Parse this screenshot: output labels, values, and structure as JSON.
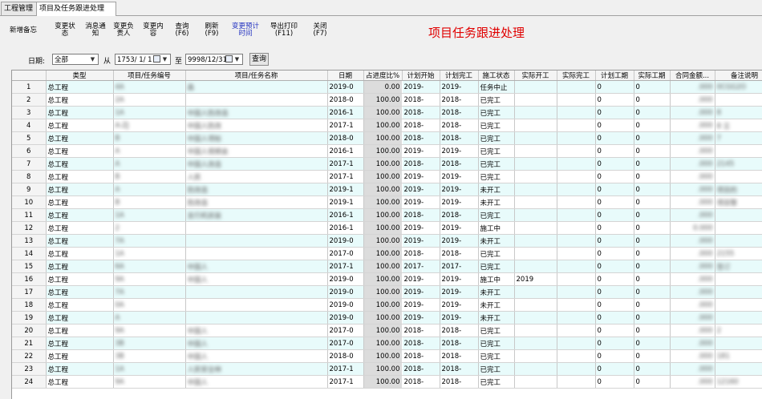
{
  "tabs": [
    {
      "label": "工程管理"
    },
    {
      "label": "项目及任务跟进处理"
    }
  ],
  "toolbar": {
    "buttons": [
      {
        "line1": "新增备忘",
        "line2": ""
      },
      {
        "line1": "变更状",
        "line2": "态"
      },
      {
        "line1": "消息通",
        "line2": "知"
      },
      {
        "line1": "变更负",
        "line2": "责人"
      },
      {
        "line1": "变更内",
        "line2": "容"
      },
      {
        "line1": "查询",
        "line2": "(F6)"
      },
      {
        "line1": "刷新",
        "line2": "(F9)"
      },
      {
        "line1": "变更预计",
        "line2": "时间"
      },
      {
        "line1": "导出打印",
        "line2": "(F11)"
      },
      {
        "line1": "关闭",
        "line2": "(F7)"
      }
    ]
  },
  "page_title": "项目任务跟进处理",
  "filter": {
    "date_label": "日期:",
    "date_range_value": "全部",
    "from_label": "从",
    "from_date": "1753/ 1/ 1",
    "to_label": "至",
    "to_date": "9998/12/31",
    "query_label": "查询"
  },
  "columns": [
    "",
    "类型",
    "项目/任务编号",
    "项目/任务名称",
    "日期",
    "占进度比%",
    "计划开始",
    "计划完工",
    "施工状态",
    "实际开工",
    "实际完工",
    "计划工期",
    "实际工期",
    "合同金额...",
    "备注说明"
  ],
  "rows": [
    {
      "n": "1",
      "type": "总工程",
      "code": "4A",
      "name": "森",
      "date": "2019-0",
      "prog": "0.00",
      "ps": "2019-",
      "pe": "2019-",
      "status": "任务中止",
      "as": "",
      "ae": "",
      "pd": "0",
      "ad": "0",
      "amt": ".000",
      "note": "0CGG2O"
    },
    {
      "n": "2",
      "type": "总工程",
      "code": "2A",
      "name": "",
      "date": "2018-0",
      "prog": "100.00",
      "ps": "2018-",
      "pe": "2018-",
      "status": "已完工",
      "as": "",
      "ae": "",
      "pd": "0",
      "ad": "0",
      "amt": ".000",
      "note": ""
    },
    {
      "n": "3",
      "type": "总工程",
      "code": "1A",
      "name": "中国人防改造",
      "date": "2016-1",
      "prog": "100.00",
      "ps": "2018-",
      "pe": "2018-",
      "status": "已完工",
      "as": "",
      "ae": "",
      "pd": "0",
      "ad": "0",
      "amt": ".000",
      "note": "8"
    },
    {
      "n": "4",
      "type": "总工程",
      "code": "A-ZJ",
      "name": "中国人防改",
      "date": "2017-1",
      "prog": "100.00",
      "ps": "2018-",
      "pe": "2018-",
      "status": "已完工",
      "as": "",
      "ae": "",
      "pd": "0",
      "ad": "0",
      "amt": ".000",
      "note": "8 立"
    },
    {
      "n": "5",
      "type": "总工程",
      "code": "B",
      "name": "中国人项标",
      "date": "2018-0",
      "prog": "100.00",
      "ps": "2018-",
      "pe": "2018-",
      "status": "已完工",
      "as": "",
      "ae": "",
      "pd": "0",
      "ad": "0",
      "amt": ".000",
      "note": "7"
    },
    {
      "n": "6",
      "type": "总工程",
      "code": "A",
      "name": "中国人视频会",
      "date": "2016-1",
      "prog": "100.00",
      "ps": "2019-",
      "pe": "2019-",
      "status": "已完工",
      "as": "",
      "ae": "",
      "pd": "0",
      "ad": "0",
      "amt": ".000",
      "note": ""
    },
    {
      "n": "7",
      "type": "总工程",
      "code": "A",
      "name": "中国人改造",
      "date": "2017-1",
      "prog": "100.00",
      "ps": "2018-",
      "pe": "2018-",
      "status": "已完工",
      "as": "",
      "ae": "",
      "pd": "0",
      "ad": "0",
      "amt": ".000",
      "note": "2145"
    },
    {
      "n": "8",
      "type": "总工程",
      "code": "B",
      "name": "人民",
      "date": "2017-1",
      "prog": "100.00",
      "ps": "2019-",
      "pe": "2019-",
      "status": "已完工",
      "as": "",
      "ae": "",
      "pd": "0",
      "ad": "0",
      "amt": ".000",
      "note": ""
    },
    {
      "n": "9",
      "type": "总工程",
      "code": "A",
      "name": "防改造",
      "date": "2019-1",
      "prog": "100.00",
      "ps": "2019-",
      "pe": "2019-",
      "status": "未开工",
      "as": "",
      "ae": "",
      "pd": "0",
      "ad": "0",
      "amt": ".000",
      "note": "项目的"
    },
    {
      "n": "10",
      "type": "总工程",
      "code": "B",
      "name": "防改造",
      "date": "2019-1",
      "prog": "100.00",
      "ps": "2019-",
      "pe": "2019-",
      "status": "未开工",
      "as": "",
      "ae": "",
      "pd": "0",
      "ad": "0",
      "amt": ".000",
      "note": "项目整"
    },
    {
      "n": "11",
      "type": "总工程",
      "code": "1A",
      "name": "支行机房装",
      "date": "2016-1",
      "prog": "100.00",
      "ps": "2018-",
      "pe": "2018-",
      "status": "已完工",
      "as": "",
      "ae": "",
      "pd": "0",
      "ad": "0",
      "amt": ".000",
      "note": ""
    },
    {
      "n": "12",
      "type": "总工程",
      "code": "2",
      "name": "",
      "date": "2016-1",
      "prog": "100.00",
      "ps": "2019-",
      "pe": "2019-",
      "status": "施工中",
      "as": "",
      "ae": "",
      "pd": "0",
      "ad": "0",
      "amt": "0.000",
      "note": ""
    },
    {
      "n": "13",
      "type": "总工程",
      "code": "7A",
      "name": "",
      "date": "2019-0",
      "prog": "100.00",
      "ps": "2019-",
      "pe": "2019-",
      "status": "未开工",
      "as": "",
      "ae": "",
      "pd": "0",
      "ad": "0",
      "amt": ".000",
      "note": ""
    },
    {
      "n": "14",
      "type": "总工程",
      "code": "1A",
      "name": "",
      "date": "2017-0",
      "prog": "100.00",
      "ps": "2018-",
      "pe": "2018-",
      "status": "已完工",
      "as": "",
      "ae": "",
      "pd": "0",
      "ad": "0",
      "amt": ".000",
      "note": "2155"
    },
    {
      "n": "15",
      "type": "总工程",
      "code": "6A",
      "name": "中国人",
      "date": "2017-1",
      "prog": "100.00",
      "ps": "2017-",
      "pe": "2017-",
      "status": "已完工",
      "as": "",
      "ae": "",
      "pd": "0",
      "ad": "0",
      "amt": ".000",
      "note": "签订"
    },
    {
      "n": "16",
      "type": "总工程",
      "code": "9A",
      "name": "中国人",
      "date": "2019-0",
      "prog": "100.00",
      "ps": "2019-",
      "pe": "2019-",
      "status": "施工中",
      "as": "2019",
      "ae": "",
      "pd": "0",
      "ad": "0",
      "amt": ".000",
      "note": ""
    },
    {
      "n": "17",
      "type": "总工程",
      "code": "7A",
      "name": "",
      "date": "2019-0",
      "prog": "100.00",
      "ps": "2019-",
      "pe": "2019-",
      "status": "未开工",
      "as": "",
      "ae": "",
      "pd": "0",
      "ad": "0",
      "amt": ".000",
      "note": ""
    },
    {
      "n": "18",
      "type": "总工程",
      "code": "0A",
      "name": "",
      "date": "2019-0",
      "prog": "100.00",
      "ps": "2019-",
      "pe": "2019-",
      "status": "未开工",
      "as": "",
      "ae": "",
      "pd": "0",
      "ad": "0",
      "amt": ".000",
      "note": ""
    },
    {
      "n": "19",
      "type": "总工程",
      "code": "A",
      "name": "",
      "date": "2019-0",
      "prog": "100.00",
      "ps": "2019-",
      "pe": "2019-",
      "status": "未开工",
      "as": "",
      "ae": "",
      "pd": "0",
      "ad": "0",
      "amt": ".000",
      "note": ""
    },
    {
      "n": "20",
      "type": "总工程",
      "code": "9A",
      "name": "中国人",
      "date": "2017-0",
      "prog": "100.00",
      "ps": "2018-",
      "pe": "2018-",
      "status": "已完工",
      "as": "",
      "ae": "",
      "pd": "0",
      "ad": "0",
      "amt": ".000",
      "note": "2"
    },
    {
      "n": "21",
      "type": "总工程",
      "code": "3B",
      "name": "中国人",
      "date": "2017-0",
      "prog": "100.00",
      "ps": "2018-",
      "pe": "2018-",
      "status": "已完工",
      "as": "",
      "ae": "",
      "pd": "0",
      "ad": "0",
      "amt": ".000",
      "note": ""
    },
    {
      "n": "22",
      "type": "总工程",
      "code": "3B",
      "name": "中国人",
      "date": "2018-0",
      "prog": "100.00",
      "ps": "2018-",
      "pe": "2018-",
      "status": "已完工",
      "as": "",
      "ae": "",
      "pd": "0",
      "ad": "0",
      "amt": ".000",
      "note": "181"
    },
    {
      "n": "23",
      "type": "总工程",
      "code": "1A",
      "name": "人民安全林",
      "date": "2017-1",
      "prog": "100.00",
      "ps": "2018-",
      "pe": "2018-",
      "status": "已完工",
      "as": "",
      "ae": "",
      "pd": "0",
      "ad": "0",
      "amt": ".000",
      "note": ""
    },
    {
      "n": "24",
      "type": "总工程",
      "code": "9A",
      "name": "中国人",
      "date": "2017-1",
      "prog": "100.00",
      "ps": "2018-",
      "pe": "2018-",
      "status": "已完工",
      "as": "",
      "ae": "",
      "pd": "0",
      "ad": "0",
      "amt": ".000",
      "note": "12160"
    }
  ]
}
